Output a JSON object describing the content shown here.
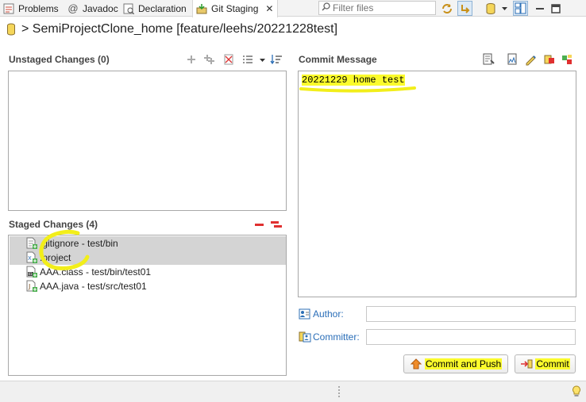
{
  "tabs": [
    {
      "label": "Problems",
      "icon": "problems-icon"
    },
    {
      "label": "Javadoc",
      "icon": "javadoc-icon"
    },
    {
      "label": "Declaration",
      "icon": "declaration-icon"
    },
    {
      "label": "Git Staging",
      "icon": "git-staging-icon",
      "active": true,
      "close": "✕"
    }
  ],
  "filter": {
    "placeholder": "Filter files"
  },
  "repository": {
    "title": "> SemiProjectClone_home [feature/leehs/20221228test]"
  },
  "unstaged": {
    "title": "Unstaged Changes (0)",
    "files": []
  },
  "staged": {
    "title": "Staged Changes (4)",
    "files": [
      {
        "label": ".gitignore - test/bin",
        "icon": "file-added-icon",
        "selected": true
      },
      {
        "label": ".project",
        "icon": "xml-file-added-icon",
        "selected": true
      },
      {
        "label": "AAA.class - test/bin/test01",
        "icon": "class-file-added-icon",
        "selected": false
      },
      {
        "label": "AAA.java - test/src/test01",
        "icon": "java-file-added-icon",
        "selected": false
      }
    ]
  },
  "commit_message": {
    "title": "Commit Message",
    "text": "20221229 home test"
  },
  "author": {
    "label": "Author:",
    "value": ""
  },
  "committer": {
    "label": "Committer:",
    "value": ""
  },
  "buttons": {
    "commit_and_push": "Commit and Push",
    "commit": "Commit"
  },
  "colors": {
    "highlight": "#fbfb2c",
    "link_blue": "#2a6eb8",
    "selection": "#d4d4d4"
  }
}
